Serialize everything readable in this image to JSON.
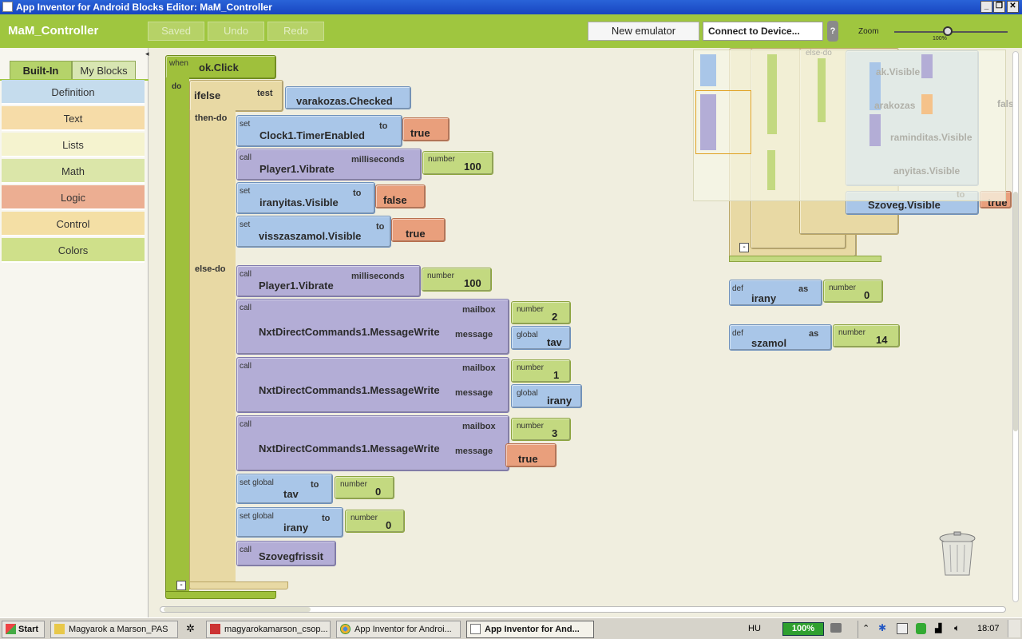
{
  "window": {
    "title": "App Inventor for Android Blocks Editor: MaM_Controller"
  },
  "header": {
    "app_name": "MaM_Controller",
    "saved": "Saved",
    "undo": "Undo",
    "redo": "Redo",
    "new_emulator": "New emulator",
    "connect": "Connect to Device...",
    "help": "?",
    "zoom": "Zoom",
    "zoom_pct": "100%",
    "zoom_level": 0.5
  },
  "sidebar": {
    "tabs": [
      "Built-In",
      "My Blocks"
    ],
    "drawers": [
      "Definition",
      "Text",
      "Lists",
      "Math",
      "Logic",
      "Control",
      "Colors"
    ]
  },
  "blocks": {
    "event": {
      "when": "when",
      "name": "ok.Click",
      "do": "do"
    },
    "ifelse": {
      "label": "ifelse",
      "test": "test",
      "then": "then-do",
      "else": "else-do",
      "cond": "varakozas.Checked"
    },
    "then": [
      {
        "kind": "set",
        "comp": "Clock1.TimerEnabled",
        "kw": "to",
        "val": "true"
      },
      {
        "kind": "call",
        "comp": "Player1.Vibrate",
        "kw": "milliseconds",
        "numlbl": "number",
        "val": "100"
      },
      {
        "kind": "set",
        "comp": "iranyitas.Visible",
        "kw": "to",
        "val": "false"
      },
      {
        "kind": "set",
        "comp": "visszaszamol.Visible",
        "kw": "to",
        "val": "true"
      }
    ],
    "else_vibrate": {
      "kind": "call",
      "comp": "Player1.Vibrate",
      "kw": "milliseconds",
      "numlbl": "number",
      "val": "100"
    },
    "msgwrite": [
      {
        "kind": "call",
        "comp": "NxtDirectCommands1.MessageWrite",
        "mb": "mailbox",
        "msg": "message",
        "numlbl": "number",
        "num": "2",
        "glbl": "global",
        "g": "tav"
      },
      {
        "kind": "call",
        "comp": "NxtDirectCommands1.MessageWrite",
        "mb": "mailbox",
        "msg": "message",
        "numlbl": "number",
        "num": "1",
        "glbl": "global",
        "g": "irany"
      },
      {
        "kind": "call",
        "comp": "NxtDirectCommands1.MessageWrite",
        "mb": "mailbox",
        "msg": "message",
        "numlbl": "number",
        "num": "3",
        "g": "true"
      }
    ],
    "setglobals": [
      {
        "kind": "set global",
        "name": "tav",
        "kw": "to",
        "numlbl": "number",
        "val": "0"
      },
      {
        "kind": "set global",
        "name": "irany",
        "kw": "to",
        "numlbl": "number",
        "val": "0"
      }
    ],
    "szoveg": {
      "kind": "call",
      "name": "Szovegfrissit"
    },
    "defs": [
      {
        "kind": "def",
        "name": "irany",
        "as": "as",
        "numlbl": "number",
        "val": "0"
      },
      {
        "kind": "def",
        "name": "szamol",
        "as": "as",
        "numlbl": "number",
        "val": "14"
      }
    ],
    "right_partial": {
      "a": "Szoveg.Visible",
      "b": "true",
      "c": "set",
      "d": "to",
      "e": "else-do",
      "f": "ak.Visible",
      "g": "arakozas",
      "h": "raminditas.Visible",
      "i": "anyitas.Visible",
      "j": "false"
    }
  },
  "taskbar": {
    "start": "Start",
    "items": [
      "Magyarok a Marson_PAS",
      "magyarokamarson_csop...",
      "App Inventor for Androi...",
      "App Inventor for And..."
    ],
    "lang": "HU",
    "battery": "100%",
    "time": "18:07"
  }
}
